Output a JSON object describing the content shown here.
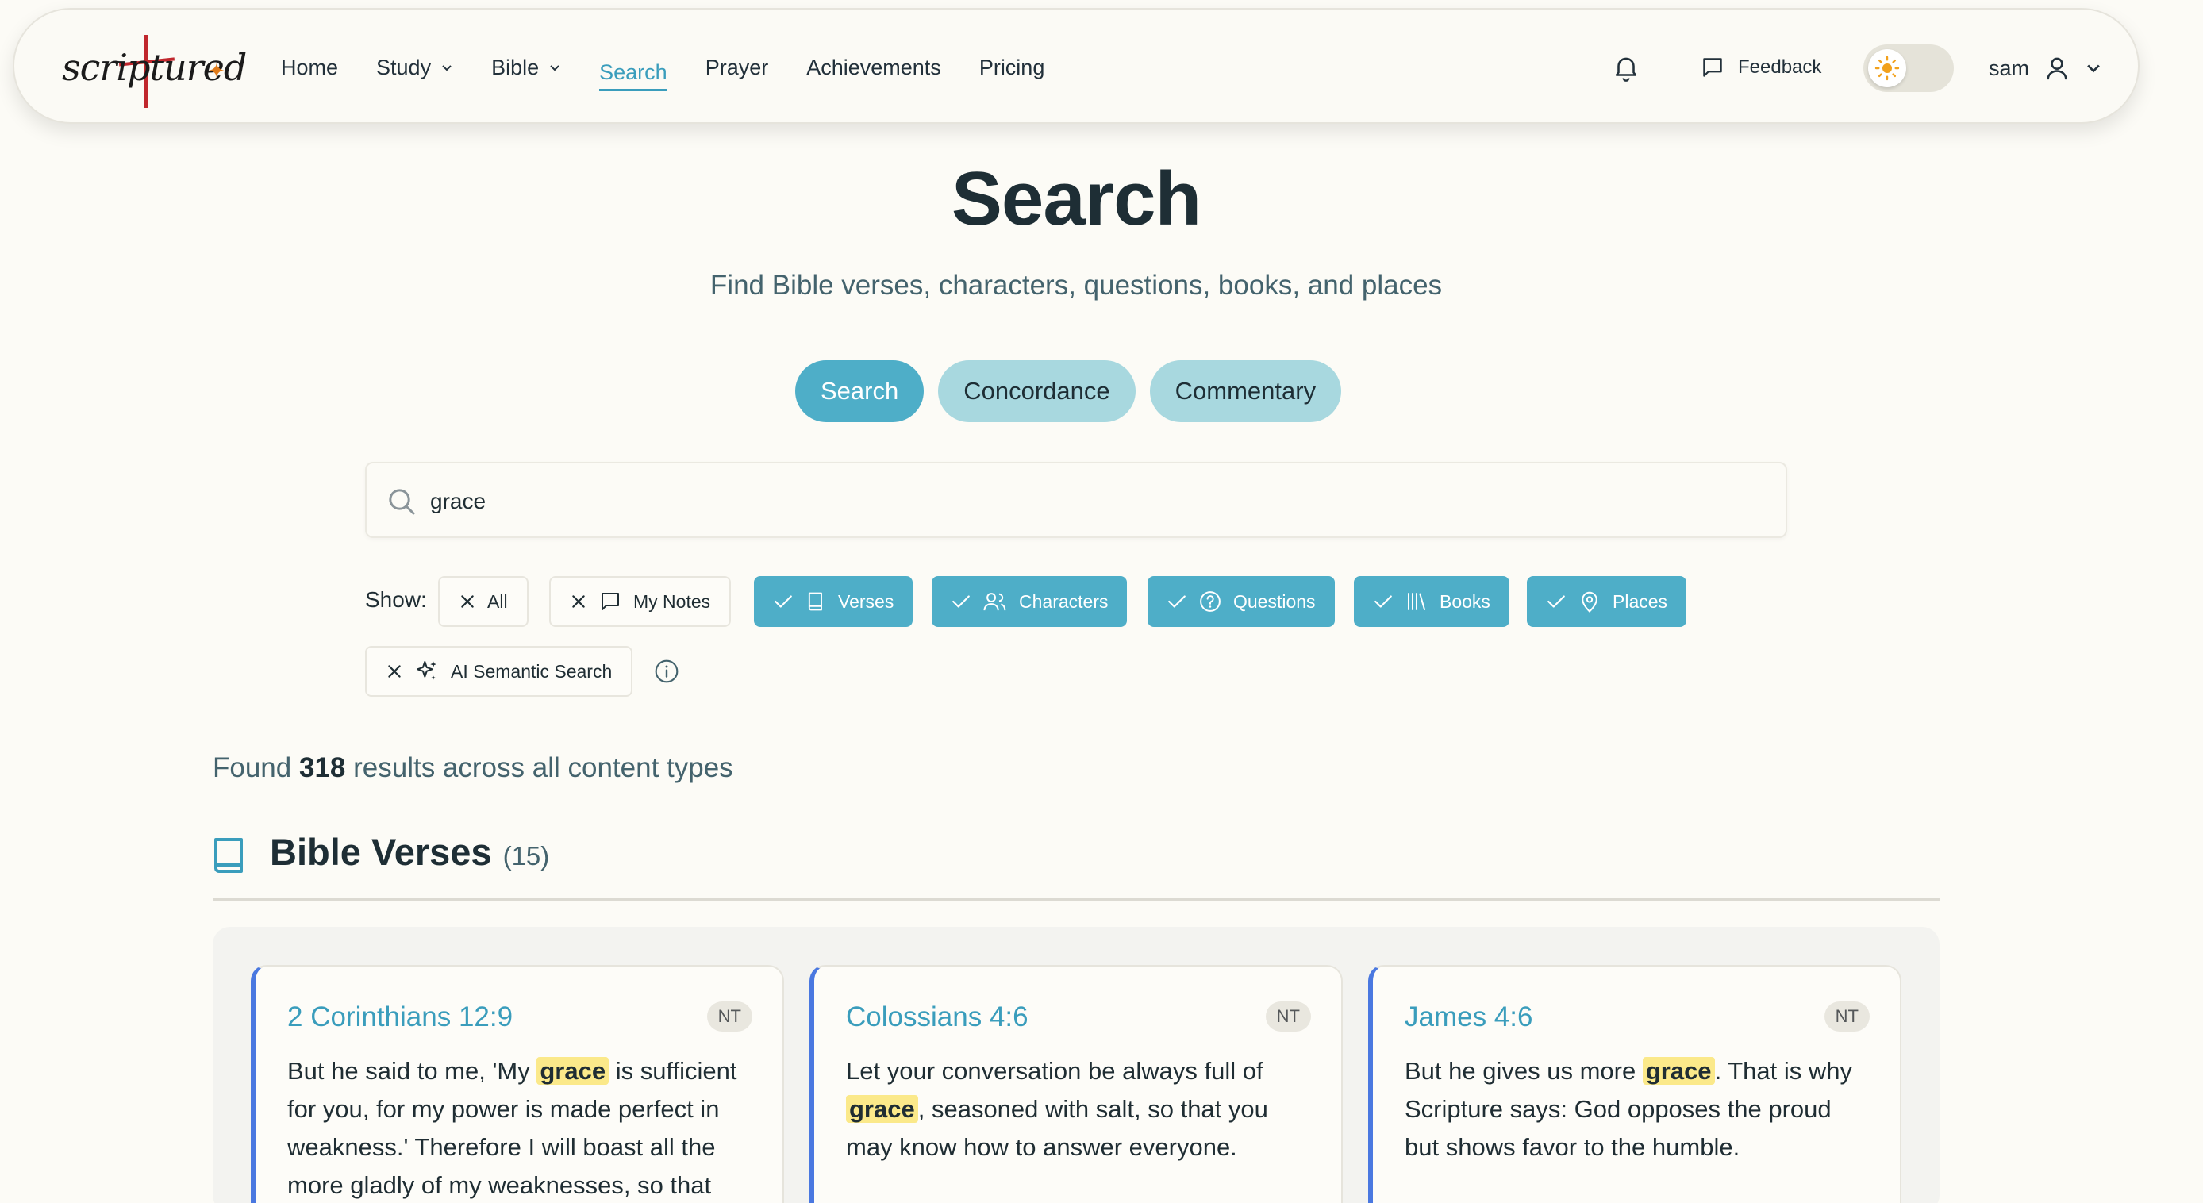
{
  "brand": {
    "logo_text": "scriptured"
  },
  "nav": {
    "home": "Home",
    "study": "Study",
    "bible": "Bible",
    "search": "Search",
    "prayer": "Prayer",
    "achievements": "Achievements",
    "pricing": "Pricing",
    "feedback": "Feedback",
    "username": "sam"
  },
  "header": {
    "title": "Search",
    "subtitle": "Find Bible verses, characters, questions, books, and places"
  },
  "modes": {
    "search": "Search",
    "concordance": "Concordance",
    "commentary": "Commentary"
  },
  "search": {
    "query": "grace"
  },
  "filters": {
    "show_label": "Show:",
    "all": "All",
    "my_notes": "My Notes",
    "verses": "Verses",
    "characters": "Characters",
    "questions": "Questions",
    "books": "Books",
    "places": "Places",
    "ai_semantic": "AI Semantic Search"
  },
  "results": {
    "found_prefix": "Found",
    "found_count": "318",
    "found_suffix": "results across all content types",
    "section_title": "Bible Verses",
    "section_count": "(15)",
    "cards": [
      {
        "ref": "2 Corinthians 12:9",
        "badge": "NT",
        "before": "But he said to me, 'My ",
        "highlight": "grace",
        "after": " is sufficient for you, for my power is made perfect in weakness.' Therefore I will boast all the more gladly of my weaknesses, so that"
      },
      {
        "ref": "Colossians 4:6",
        "badge": "NT",
        "before": "Let your conversation be always full of ",
        "highlight": "grace",
        "after": ", seasoned with salt, so that you may know how to answer everyone."
      },
      {
        "ref": "James 4:6",
        "badge": "NT",
        "before": "But he gives us more ",
        "highlight": "grace",
        "after": ". That is why Scripture says: God opposes the proud but shows favor to the humble."
      }
    ]
  },
  "colors": {
    "accent": "#4eaec8",
    "accent_light": "#a8d8df",
    "link": "#3a9dbc",
    "card_border": "#4a78e0",
    "highlight": "#fbe98a"
  }
}
